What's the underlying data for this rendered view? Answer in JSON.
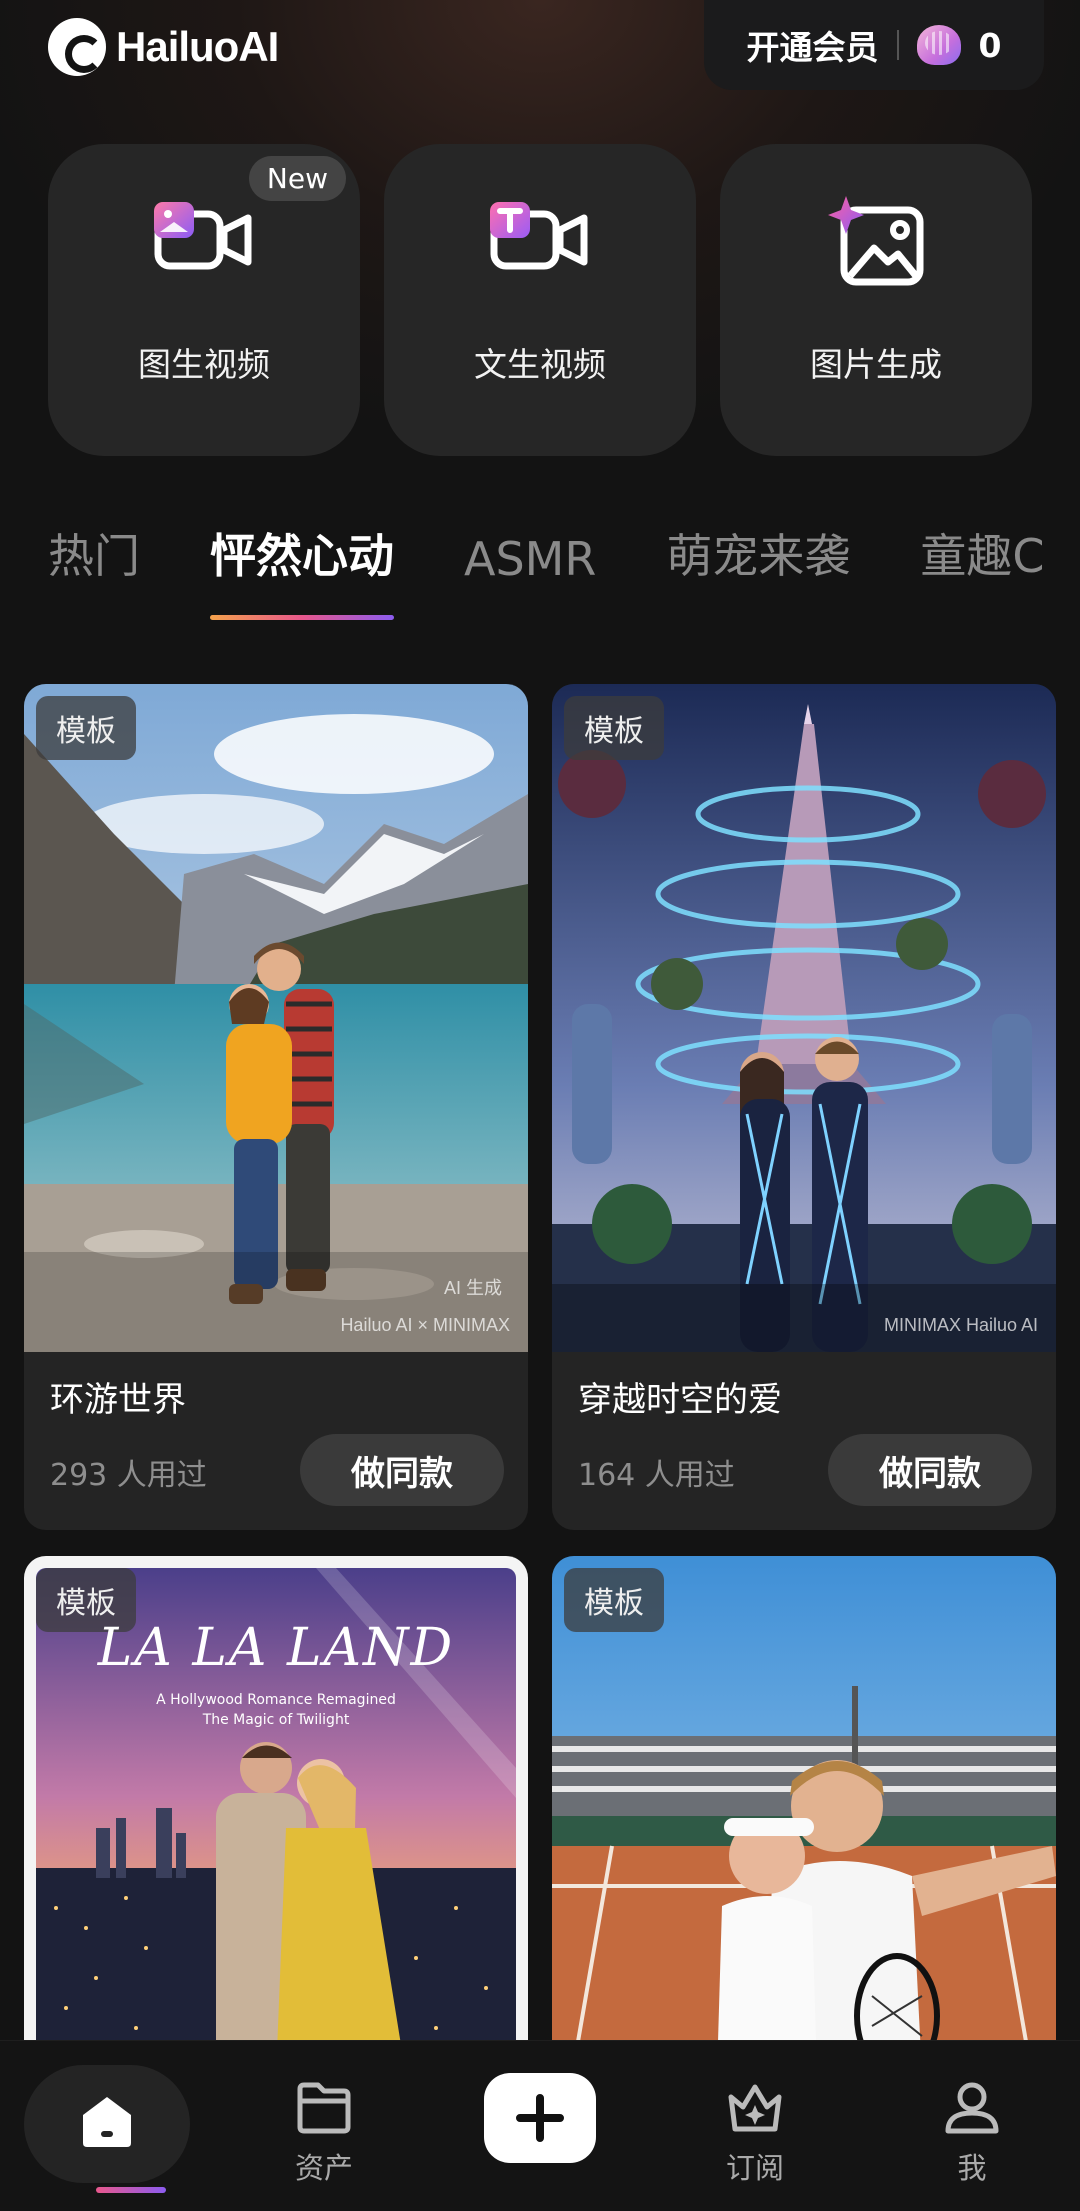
{
  "header": {
    "logo_text": "HailuoAI",
    "vip_label": "开通会员",
    "shell_count": "0"
  },
  "tools": [
    {
      "label": "图生视频",
      "badge": "New"
    },
    {
      "label": "文生视频"
    },
    {
      "label": "图片生成"
    }
  ],
  "tabs": [
    "热门",
    "怦然心动",
    "ASMR",
    "萌宠来袭",
    "童趣C"
  ],
  "active_tab": "怦然心动",
  "cards": [
    {
      "badge": "模板",
      "title": "环游世界",
      "uses": "293 人用过",
      "button": "做同款",
      "watermark": "Hailuo AI × MINIMAX",
      "ai_label": "AI 生成"
    },
    {
      "badge": "模板",
      "title": "穿越时空的爱",
      "uses": "164 人用过",
      "button": "做同款",
      "watermark": "MINIMAX  Hailuo AI"
    },
    {
      "badge": "模板",
      "poster_title": "LA LA LAND",
      "poster_sub1": "A Hollywood Romance Remagined",
      "poster_sub2": "The Magic of Twilight"
    },
    {
      "badge": "模板"
    }
  ],
  "nav": [
    {
      "label": "",
      "icon": "home-icon"
    },
    {
      "label": "资产",
      "icon": "folder-icon"
    },
    {
      "label": "",
      "icon": "plus-icon"
    },
    {
      "label": "订阅",
      "icon": "crown-icon"
    },
    {
      "label": "我",
      "icon": "user-icon"
    }
  ]
}
